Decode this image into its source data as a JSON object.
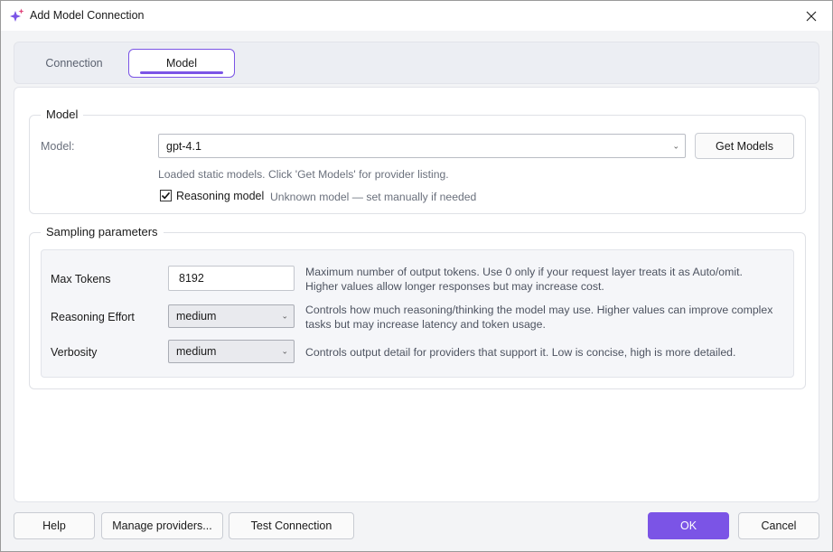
{
  "window": {
    "title": "Add Model Connection",
    "icon": "sparkle-icon",
    "accent_color": "#7b54e6"
  },
  "tabs": [
    {
      "label": "Connection",
      "active": false
    },
    {
      "label": "Model",
      "active": true
    }
  ],
  "model_group": {
    "title": "Model",
    "model_label": "Model:",
    "model_value": "gpt-4.1",
    "get_models_label": "Get Models",
    "hint": "Loaded static models. Click 'Get Models' for provider listing.",
    "reasoning_checkbox_label": "Reasoning model",
    "reasoning_checked": true,
    "reasoning_note": "Unknown model — set manually if needed"
  },
  "sampling": {
    "title": "Sampling parameters",
    "max_tokens": {
      "label": "Max Tokens",
      "value": "8192",
      "desc_line1": "Maximum number of output tokens. Use 0 only if your request layer treats it as Auto/omit.",
      "desc_line2": "Higher values allow longer responses but may increase cost."
    },
    "reasoning_effort": {
      "label": "Reasoning Effort",
      "value": "medium",
      "desc_line1": "Controls how much reasoning/thinking the model may use. Higher values can improve complex",
      "desc_line2": "tasks but may increase latency and token usage."
    },
    "verbosity": {
      "label": "Verbosity",
      "value": "medium",
      "desc_line1": "Controls output detail for providers that support it. Low is concise, high is more detailed."
    }
  },
  "footer": {
    "help": "Help",
    "manage_providers": "Manage providers...",
    "test_connection": "Test Connection",
    "ok": "OK",
    "cancel": "Cancel"
  }
}
